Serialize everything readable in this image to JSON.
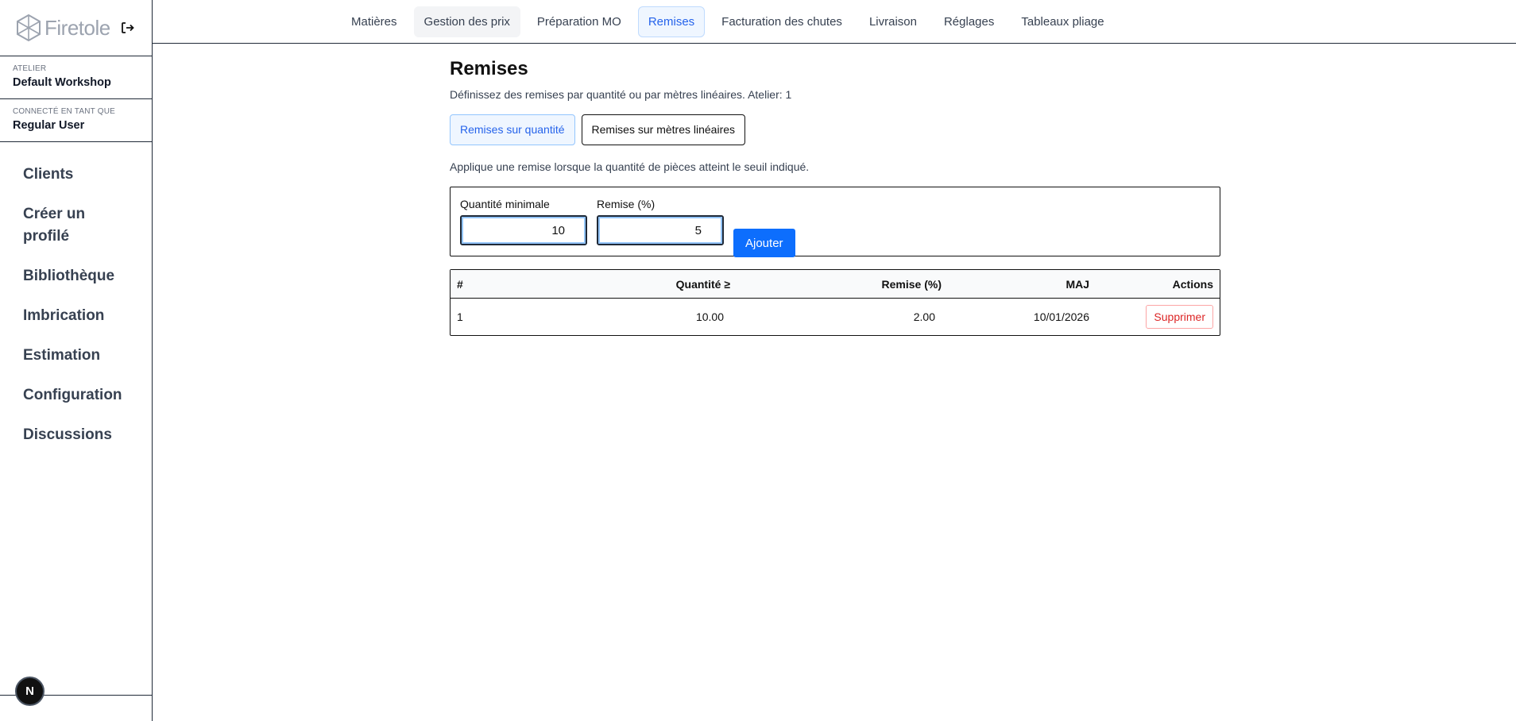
{
  "brand": {
    "name": "Firetole"
  },
  "sidebar": {
    "workshop_label": "ATELIER",
    "workshop_value": "Default Workshop",
    "user_label": "CONNECTÉ EN TANT QUE",
    "user_value": "Regular User",
    "items": [
      {
        "label": "Clients"
      },
      {
        "label": "Créer un profilé"
      },
      {
        "label": "Bibliothèque"
      },
      {
        "label": "Imbrication"
      },
      {
        "label": "Estimation"
      },
      {
        "label": "Configuration"
      },
      {
        "label": "Discussions"
      }
    ],
    "badge": "N"
  },
  "topnav": {
    "tabs": [
      {
        "label": "Matières"
      },
      {
        "label": "Gestion des prix"
      },
      {
        "label": "Préparation MO"
      },
      {
        "label": "Remises"
      },
      {
        "label": "Facturation des chutes"
      },
      {
        "label": "Livraison"
      },
      {
        "label": "Réglages"
      },
      {
        "label": "Tableaux pliage"
      }
    ],
    "active_tab": "Remises"
  },
  "main": {
    "title": "Remises",
    "subtitle": "Définissez des remises par quantité ou par mètres linéaires. Atelier: 1",
    "segments": [
      {
        "label": "Remises sur quantité"
      },
      {
        "label": "Remises sur mètres linéaires"
      }
    ],
    "description": "Applique une remise lorsque la quantité de pièces atteint le seuil indiqué.",
    "form": {
      "min_qty_label": "Quantité minimale",
      "min_qty_value": "10",
      "discount_label": "Remise (%)",
      "discount_value": "5",
      "add_label": "Ajouter"
    },
    "table": {
      "headers": [
        "#",
        "Quantité ≥",
        "Remise (%)",
        "MAJ",
        "Actions"
      ],
      "rows": [
        {
          "id": "1",
          "qty": "10.00",
          "discount": "2.00",
          "updated": "10/01/2026",
          "action": "Supprimer"
        }
      ]
    }
  }
}
